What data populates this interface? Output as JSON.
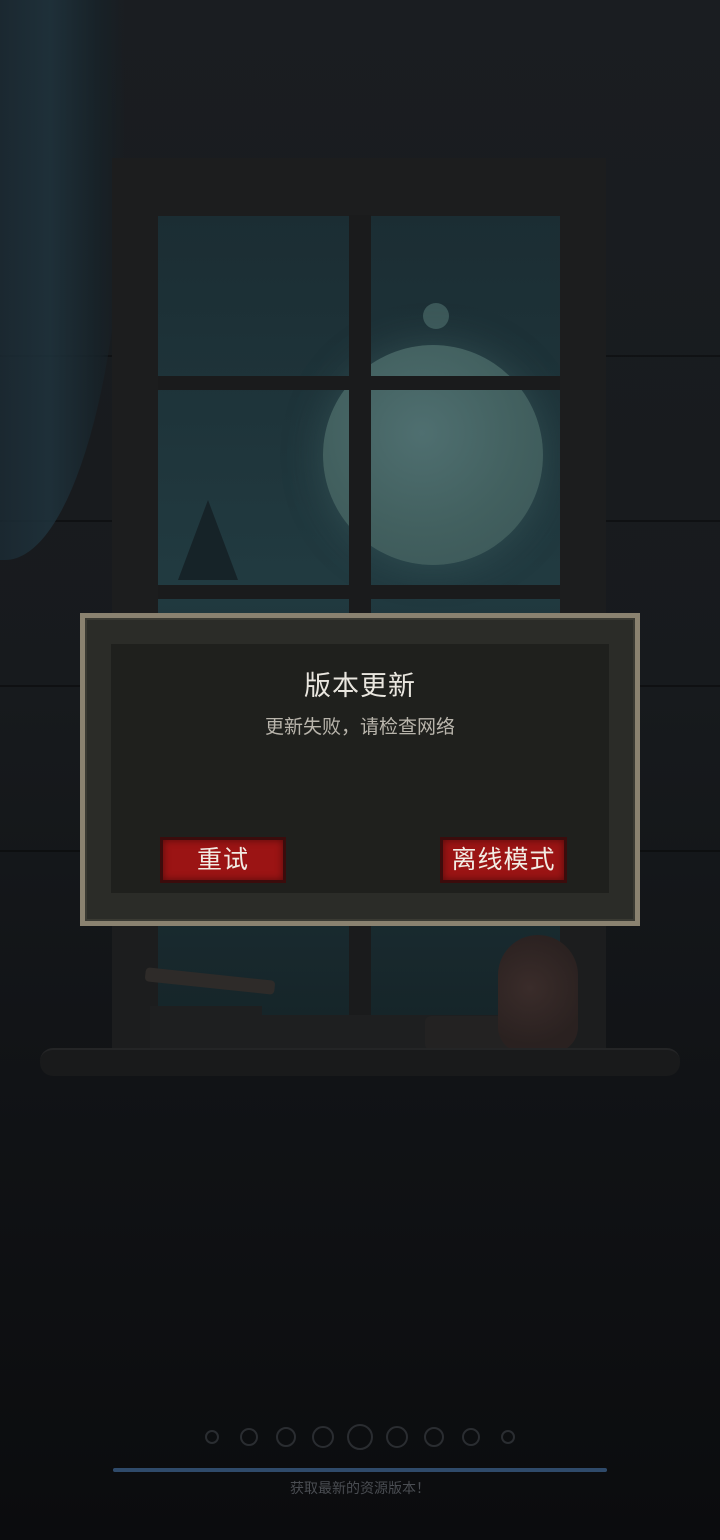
{
  "dialog": {
    "title": "版本更新",
    "message": "更新失败，请检查网络",
    "retry_label": "重试",
    "offline_label": "离线模式"
  },
  "loading": {
    "status_text": "获取最新的资源版本！",
    "progress": 1.0,
    "dots_count": 9
  },
  "colors": {
    "button_red": "#9b1414",
    "dialog_border": "#8a8270",
    "progress_blue": "#2f4a6a"
  }
}
